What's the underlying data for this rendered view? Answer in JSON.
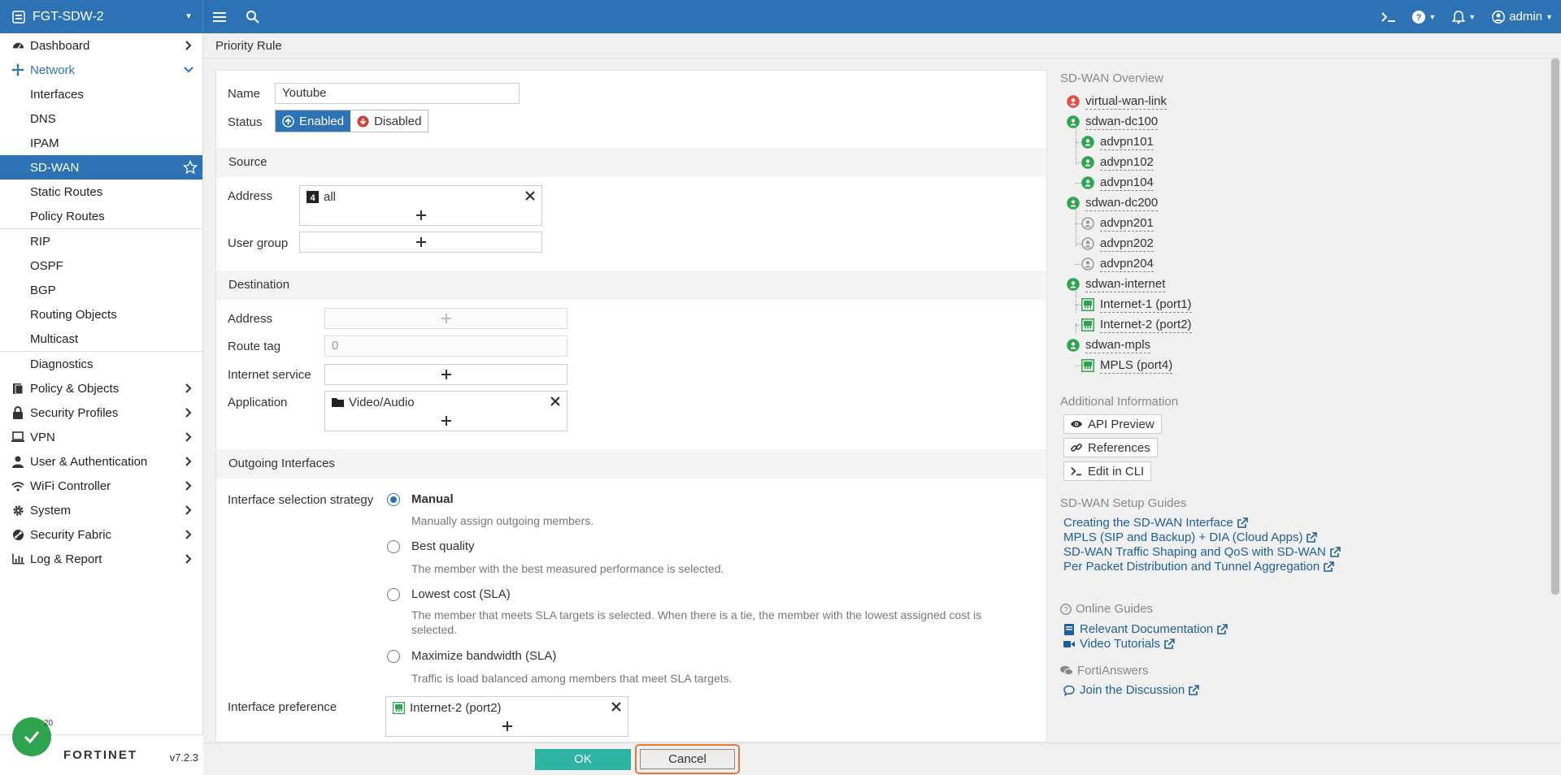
{
  "topbar": {
    "device_name": "FGT-SDW-2",
    "user": "admin"
  },
  "sidebar": {
    "items": [
      {
        "label": "Dashboard",
        "icon": "dashboard-icon"
      },
      {
        "label": "Network",
        "icon": "network-icon"
      },
      {
        "label": "Interfaces"
      },
      {
        "label": "DNS"
      },
      {
        "label": "IPAM"
      },
      {
        "label": "SD-WAN"
      },
      {
        "label": "Static Routes"
      },
      {
        "label": "Policy Routes"
      },
      {
        "label": "RIP"
      },
      {
        "label": "OSPF"
      },
      {
        "label": "BGP"
      },
      {
        "label": "Routing Objects"
      },
      {
        "label": "Multicast"
      },
      {
        "label": "Diagnostics"
      },
      {
        "label": "Policy & Objects",
        "icon": "policy-icon"
      },
      {
        "label": "Security Profiles",
        "icon": "lock-icon"
      },
      {
        "label": "VPN",
        "icon": "laptop-icon"
      },
      {
        "label": "User & Authentication",
        "icon": "user-icon"
      },
      {
        "label": "WiFi Controller",
        "icon": "wifi-icon"
      },
      {
        "label": "System",
        "icon": "gear-icon"
      },
      {
        "label": "Security Fabric",
        "icon": "fabric-icon"
      },
      {
        "label": "Log & Report",
        "icon": "chart-icon"
      }
    ],
    "notification_count": "20",
    "logo": "FORTINET",
    "version": "v7.2.3"
  },
  "page": {
    "title": "Priority Rule"
  },
  "form": {
    "name_label": "Name",
    "name_value": "Youtube",
    "status_label": "Status",
    "status_enabled": "Enabled",
    "status_disabled": "Disabled",
    "source_section": "Source",
    "src_address_label": "Address",
    "src_address_value": "all",
    "user_group_label": "User group",
    "destination_section": "Destination",
    "dst_address_label": "Address",
    "route_tag_label": "Route tag",
    "route_tag_placeholder": "0",
    "internet_service_label": "Internet service",
    "application_label": "Application",
    "application_value": "Video/Audio",
    "outgoing_section": "Outgoing Interfaces",
    "strategy_label": "Interface selection strategy",
    "strategies": [
      {
        "label": "Manual",
        "desc": "Manually assign outgoing members.",
        "checked": true
      },
      {
        "label": "Best quality",
        "desc": "The member with the best measured performance is selected.",
        "checked": false
      },
      {
        "label": "Lowest cost (SLA)",
        "desc": "The member that meets SLA targets is selected. When there is a tie, the member with the lowest assigned cost is selected.",
        "checked": false
      },
      {
        "label": "Maximize bandwidth (SLA)",
        "desc": "Traffic is load balanced among members that meet SLA targets.",
        "checked": false
      }
    ],
    "interface_pref_label": "Interface preference",
    "interface_pref_value": "Internet-2 (port2)"
  },
  "buttons": {
    "ok": "OK",
    "cancel": "Cancel"
  },
  "overview": {
    "title": "SD-WAN Overview",
    "tree": [
      {
        "label": "virtual-wan-link",
        "level": 0,
        "status": "down"
      },
      {
        "label": "sdwan-dc100",
        "level": 0,
        "status": "up"
      },
      {
        "label": "advpn101",
        "level": 1,
        "status": "up"
      },
      {
        "label": "advpn102",
        "level": 1,
        "status": "up"
      },
      {
        "label": "advpn104",
        "level": 1,
        "status": "up"
      },
      {
        "label": "sdwan-dc200",
        "level": 0,
        "status": "up"
      },
      {
        "label": "advpn201",
        "level": 1,
        "status": "inactive"
      },
      {
        "label": "advpn202",
        "level": 1,
        "status": "inactive"
      },
      {
        "label": "advpn204",
        "level": 1,
        "status": "inactive"
      },
      {
        "label": "sdwan-internet",
        "level": 0,
        "status": "up"
      },
      {
        "label": "Internet-1 (port1)",
        "level": 1,
        "status": "port"
      },
      {
        "label": "Internet-2 (port2)",
        "level": 1,
        "status": "port"
      },
      {
        "label": "sdwan-mpls",
        "level": 0,
        "status": "up"
      },
      {
        "label": "MPLS (port4)",
        "level": 1,
        "status": "port"
      }
    ],
    "additional_title": "Additional Information",
    "api_preview": "API Preview",
    "references": "References",
    "edit_cli": "Edit in CLI",
    "setup_title": "SD-WAN Setup Guides",
    "setup_links": [
      "Creating the SD-WAN Interface",
      "MPLS (SIP and Backup) + DIA (Cloud Apps)",
      "SD-WAN Traffic Shaping and QoS with SD-WAN",
      "Per Packet Distribution and Tunnel Aggregation"
    ],
    "online_title": "Online Guides",
    "relevant_docs": "Relevant Documentation",
    "video_tutorials": "Video Tutorials",
    "fortianswers_title": "FortiAnswers",
    "join_discussion": "Join the Discussion"
  },
  "colors": {
    "brand_blue": "#2e72b6",
    "ok_green": "#2fb3a2",
    "status_up": "#2ea44f",
    "status_down": "#d9534f"
  }
}
